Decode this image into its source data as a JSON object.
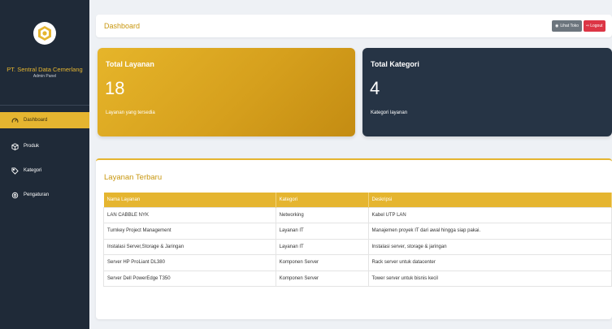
{
  "sidebar": {
    "brand": "PT. Sentral Data Cemerlang",
    "subtitle": "Admin Panel",
    "logo_icon": "hexagon-logo-icon",
    "items": [
      {
        "label": "Dashboard",
        "icon": "speedometer-icon",
        "active": true
      },
      {
        "label": "Produk",
        "icon": "box-icon",
        "active": false
      },
      {
        "label": "Kategori",
        "icon": "tag-icon",
        "active": false
      },
      {
        "label": "Pengaturan",
        "icon": "gear-icon",
        "active": false
      }
    ]
  },
  "header": {
    "title": "Dashboard",
    "view_store_label": "Lihat Toko",
    "logout_label": "Logout"
  },
  "stats": {
    "services": {
      "title": "Total Layanan",
      "value": "18",
      "desc": "Layanan yang tersedia"
    },
    "categories": {
      "title": "Total Kategori",
      "value": "4",
      "desc": "Kategori layanan"
    }
  },
  "recent": {
    "title": "Layanan Terbaru",
    "columns": [
      "Nama Layanan",
      "Kategori",
      "Deskripsi"
    ],
    "rows": [
      [
        "LAN CABBLE NYK",
        "Networking",
        "Kabel UTP LAN"
      ],
      [
        "Turnkey Project Management",
        "Layanan IT",
        "Manajemen proyek IT dari awal hingga siap pakai."
      ],
      [
        "Instalasi Server,Storage & Jaringan",
        "Layanan IT",
        "Instalasi server, storage & jaringan"
      ],
      [
        "Server HP ProLiant DL380",
        "Komponen Server",
        "Rack server untuk datacenter"
      ],
      [
        "Server Dell PowerEdge T350",
        "Komponen Server",
        "Tower server untuk bisnis kecil"
      ]
    ]
  },
  "colors": {
    "accent": "#e5b530",
    "sidebar_bg": "#1f2a38",
    "dark_card": "#263445",
    "logout": "#dc3545",
    "secondary": "#6c757d"
  }
}
